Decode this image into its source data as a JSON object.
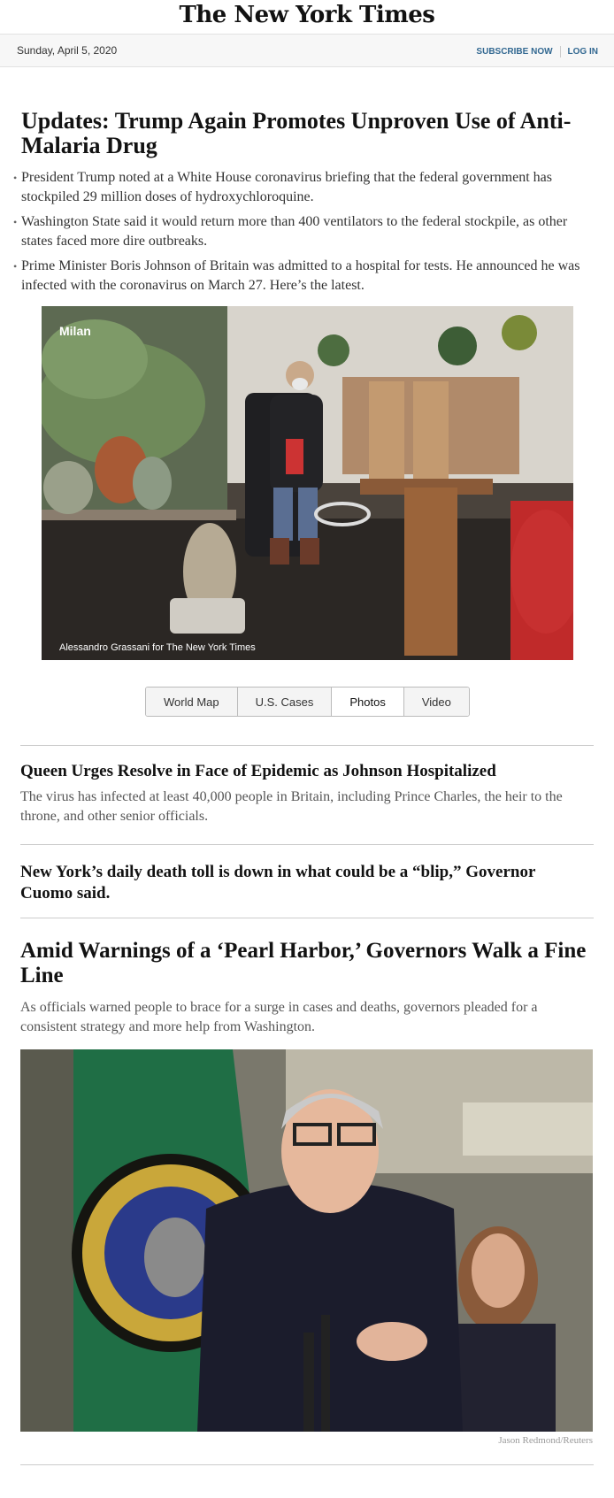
{
  "masthead": {
    "logo": "The New York Times"
  },
  "datebar": {
    "date": "Sunday, April 5, 2020",
    "subscribe": "SUBSCRIBE NOW",
    "login": "LOG IN"
  },
  "lead": {
    "headline": "Updates: Trump Again Promotes Unproven Use of Anti-Malaria Drug",
    "bullets": [
      "President Trump noted at a White House coronavirus briefing that the federal government has stockpiled 29 million doses of hydroxychloroquine.",
      "Washington State said it would return more than 400 ventilators to the federal stockpile, as other states faced more dire outbreaks.",
      "Prime Minister Boris Johnson of Britain was admitted to a hospital for tests. He announced he was infected with the coronavirus on March 27. Here’s the latest."
    ],
    "photo_label": "Milan",
    "photo_credit": "Alessandro Grassani for The New York Times"
  },
  "tabs": {
    "items": [
      "World Map",
      "U.S. Cases",
      "Photos",
      "Video"
    ],
    "active": "Photos"
  },
  "stories": [
    {
      "headline": "Queen Urges Resolve in Face of Epidemic as Johnson Hospitalized",
      "summary": "The virus has infected at least 40,000 people in Britain, including Prince Charles, the heir to the throne, and other senior officials."
    },
    {
      "headline": "New York’s daily death toll is down in what could be a “blip,” Governor Cuomo said."
    },
    {
      "headline": "Amid Warnings of a ‘Pearl Harbor,’ Governors Walk a Fine Line",
      "summary": "As officials warned people to brace for a surge in cases and deaths, governors pleaded for a consistent strategy and more help from Washington.",
      "photo_credit": "Jason Redmond/Reuters"
    }
  ]
}
